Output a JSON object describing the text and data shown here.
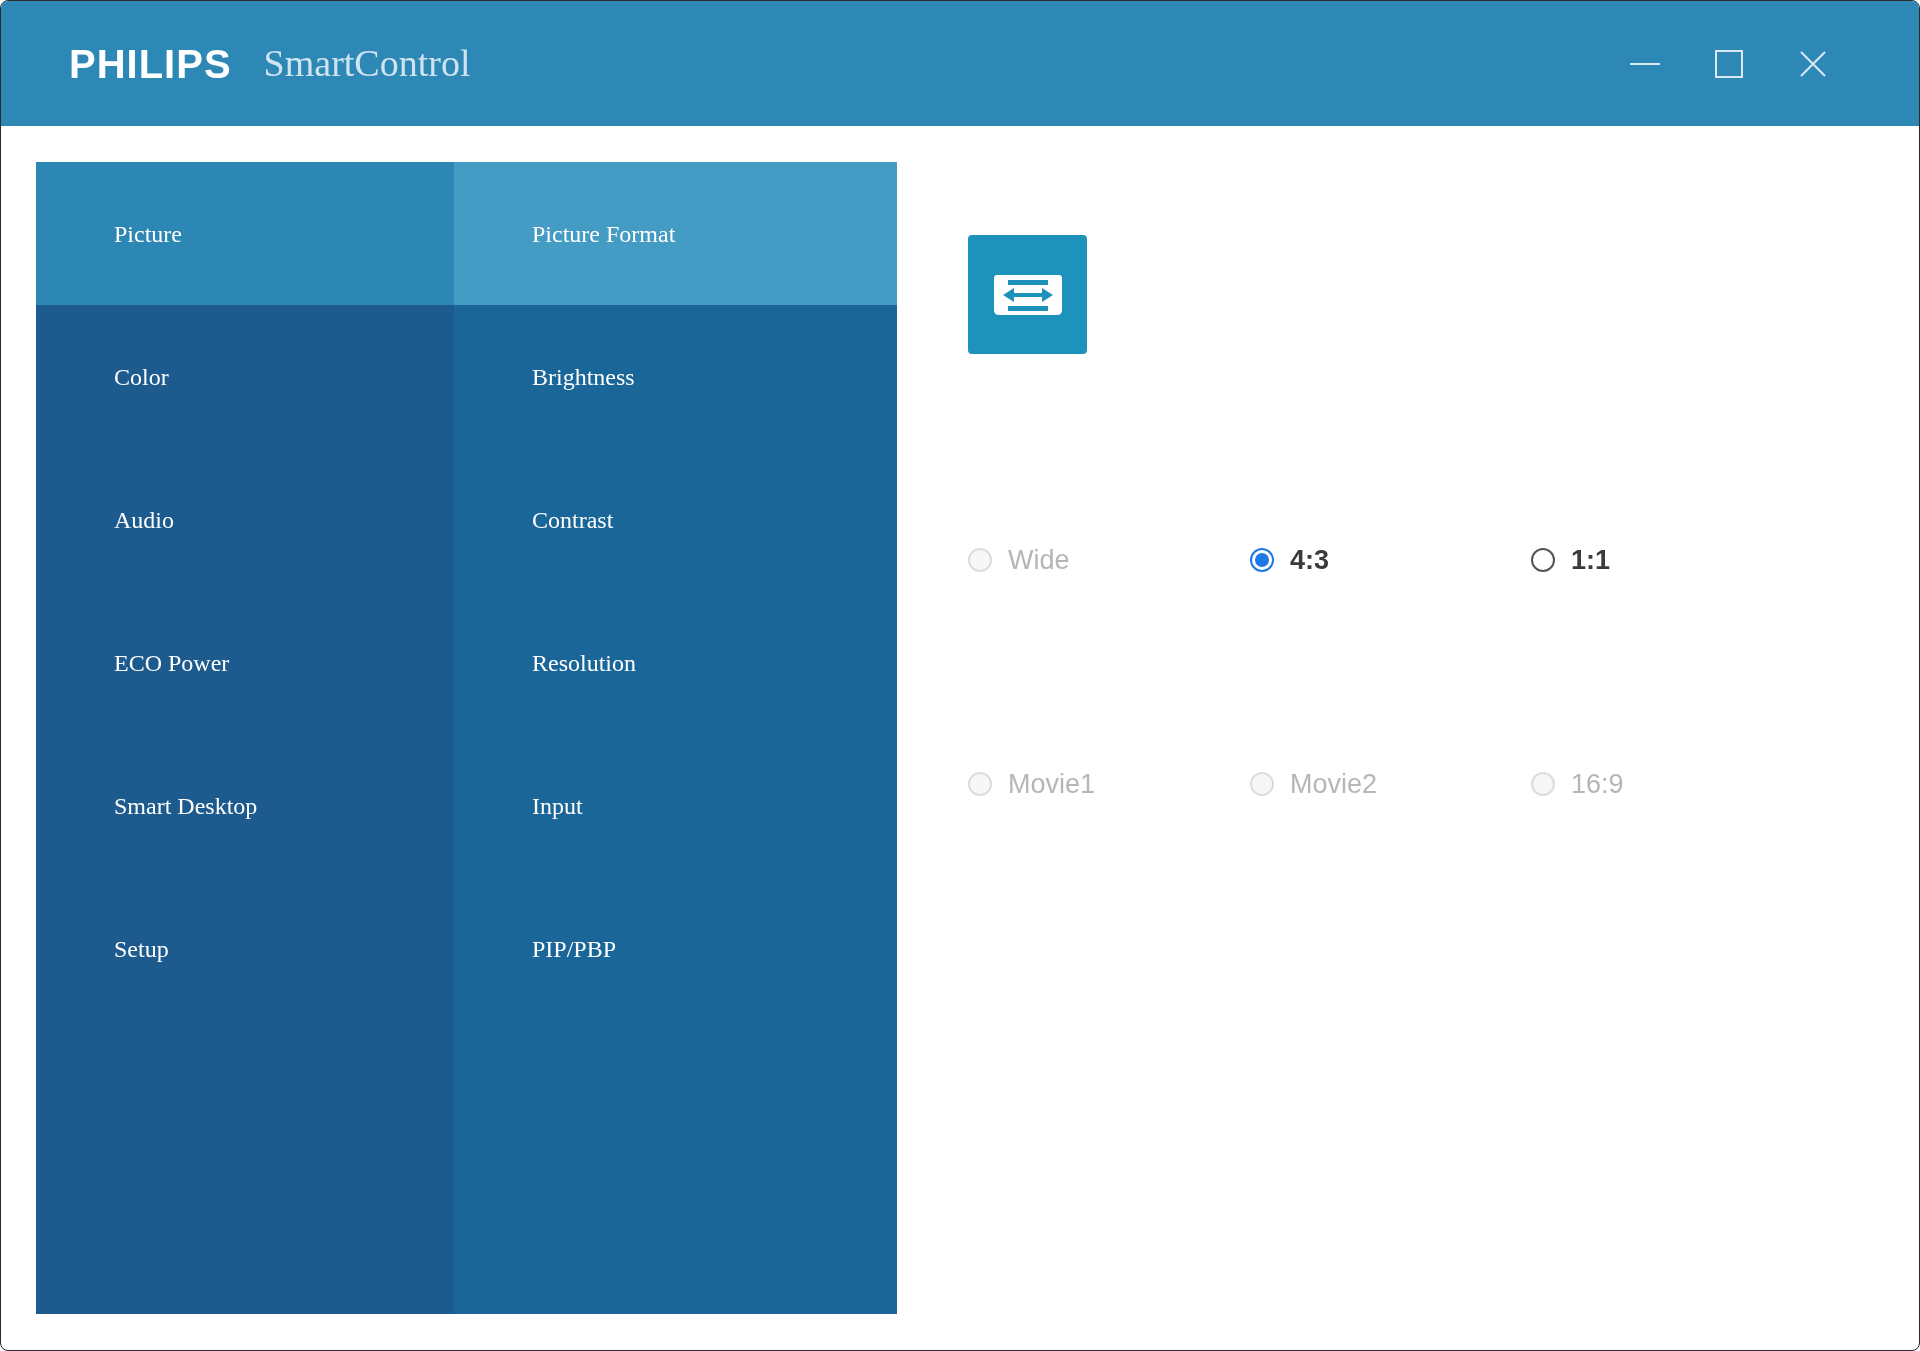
{
  "window": {
    "brand": "PHILIPS",
    "title": "SmartControl"
  },
  "categories": [
    {
      "label": "Picture",
      "selected": true
    },
    {
      "label": "Color",
      "selected": false
    },
    {
      "label": "Audio",
      "selected": false
    },
    {
      "label": "ECO Power",
      "selected": false
    },
    {
      "label": "Smart Desktop",
      "selected": false
    },
    {
      "label": "Setup",
      "selected": false
    }
  ],
  "subitems": [
    {
      "label": "Picture Format",
      "selected": true
    },
    {
      "label": "Brightness",
      "selected": false
    },
    {
      "label": "Contrast",
      "selected": false
    },
    {
      "label": "Resolution",
      "selected": false
    },
    {
      "label": "Input",
      "selected": false
    },
    {
      "label": "PIP/PBP",
      "selected": false
    }
  ],
  "format_options": [
    {
      "label": "Wide",
      "selected": false,
      "disabled": true
    },
    {
      "label": "4:3",
      "selected": true,
      "disabled": false
    },
    {
      "label": "1:1",
      "selected": false,
      "disabled": false
    },
    {
      "label": "Movie1",
      "selected": false,
      "disabled": true
    },
    {
      "label": "Movie2",
      "selected": false,
      "disabled": true
    },
    {
      "label": "16:9",
      "selected": false,
      "disabled": true
    }
  ]
}
